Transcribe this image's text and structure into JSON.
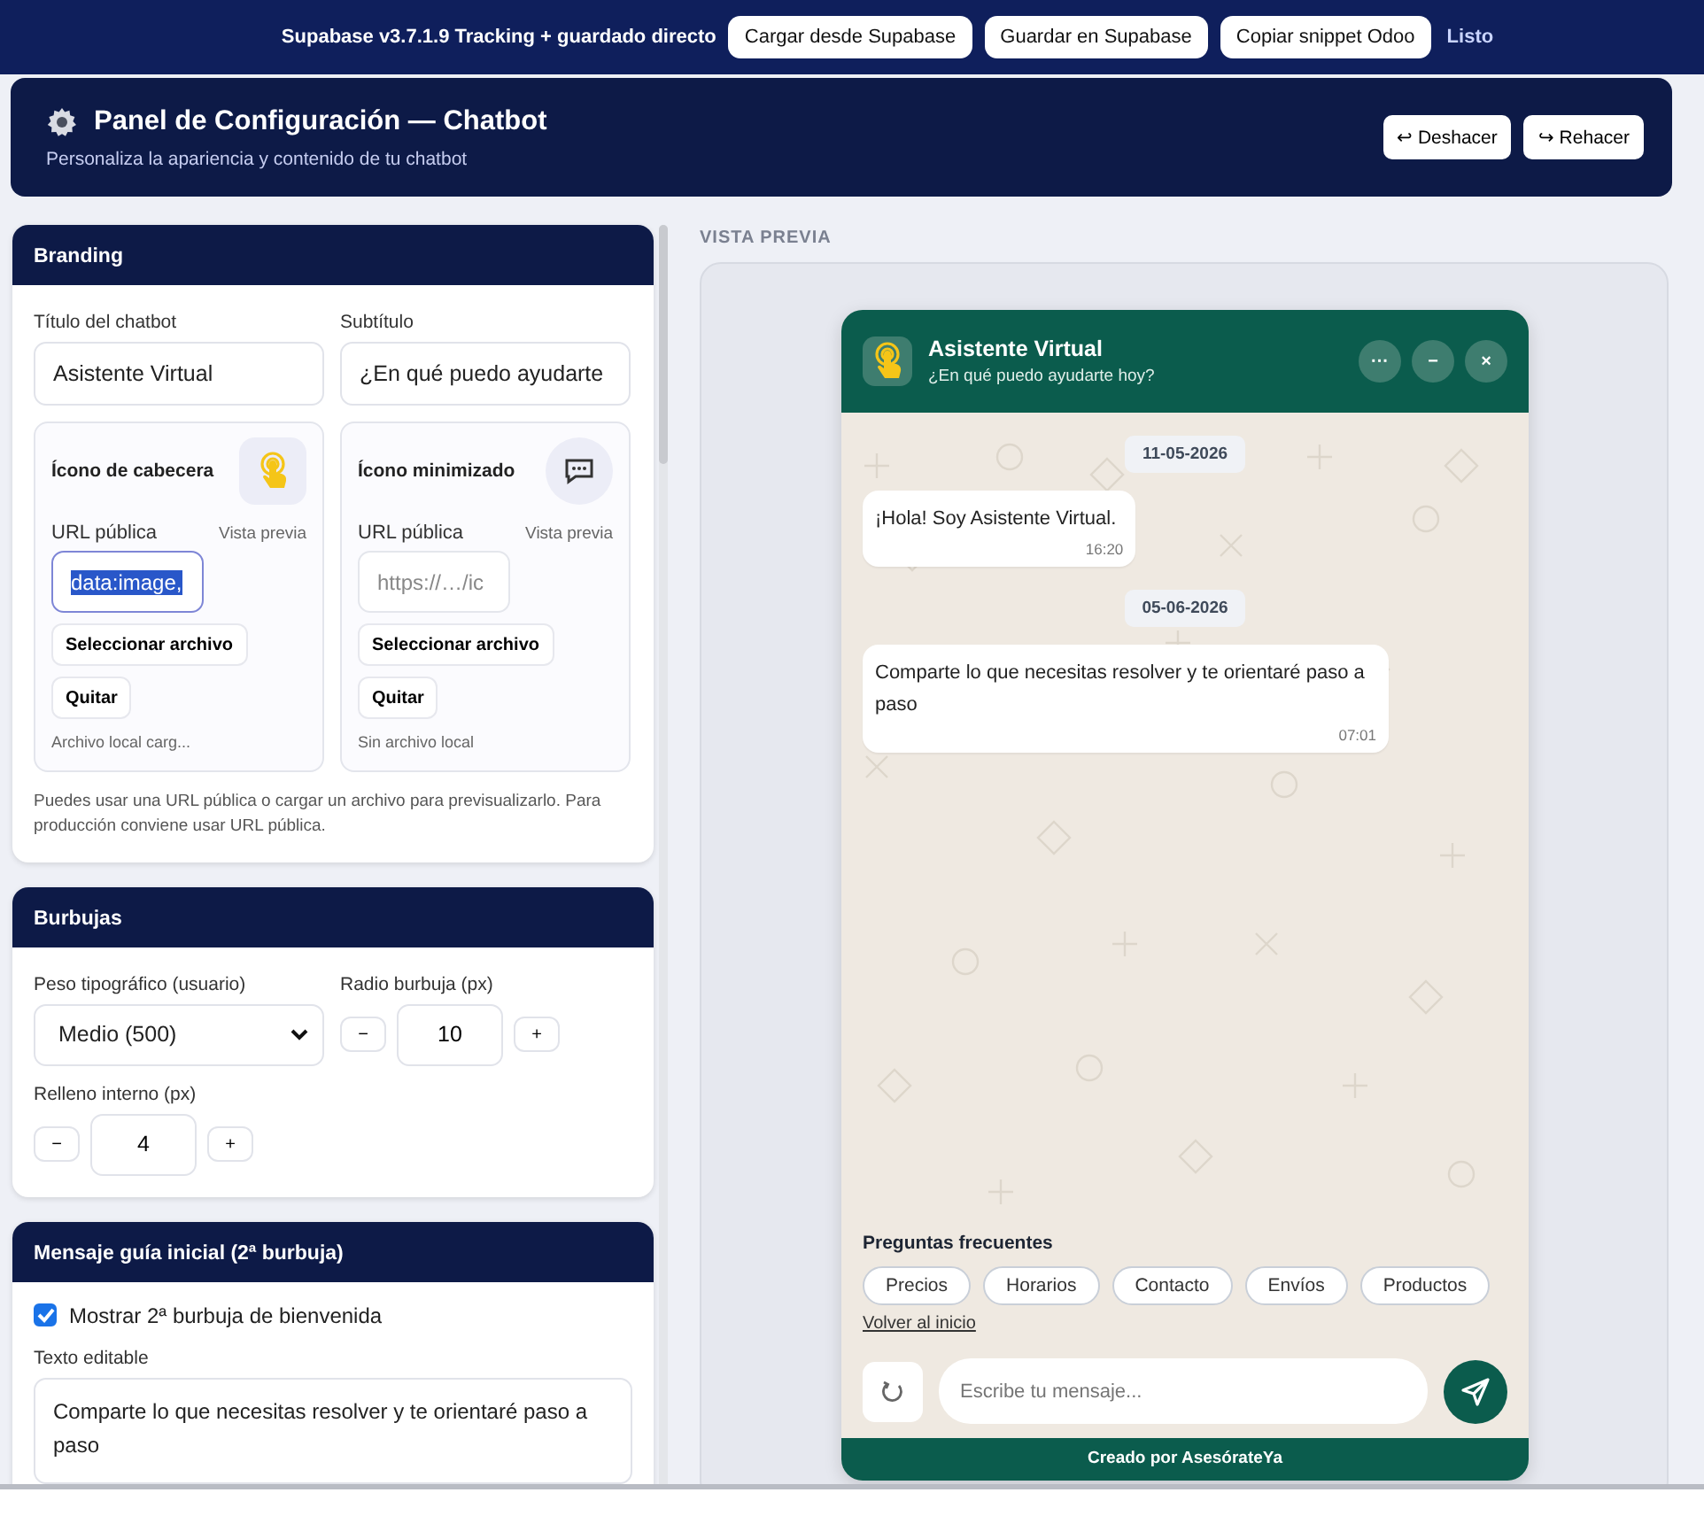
{
  "top_bar": {
    "title": "Supabase v3.7.1.9 Tracking + guardado directo",
    "buttons": [
      "Cargar desde Supabase",
      "Guardar en Supabase",
      "Copiar snippet Odoo"
    ],
    "link": "Listo"
  },
  "header": {
    "title": "Panel de Configuración — Chatbot",
    "subtitle": "Personaliza la apariencia y contenido de tu chatbot",
    "buttons": [
      "↩ Deshacer",
      "↪ Rehacer"
    ]
  },
  "branding": {
    "title": "Branding",
    "fields": [
      {
        "label": "Título del chatbot",
        "value": "Asistente Virtual"
      },
      {
        "label": "Subtítulo",
        "value": "¿En qué puedo ayudarte"
      }
    ],
    "icon_cards": [
      {
        "kind": "hand",
        "title": "Ícono de cabecera",
        "url_label": "URL pública",
        "preview_label": "Vista previa",
        "value": "data:image,",
        "selected": true,
        "select_button": "Seleccionar archivo",
        "remove_button": "Quitar",
        "status": "Archivo local carg..."
      },
      {
        "kind": "chat",
        "title": "Ícono minimizado",
        "url_label": "URL pública",
        "preview_label": "Vista previa",
        "placeholder": "https://…/ic",
        "selected": false,
        "select_button": "Seleccionar archivo",
        "remove_button": "Quitar",
        "status": "Sin archivo local"
      }
    ],
    "note": "Puedes usar una URL pública o cargar un archivo para previsualizarlo. Para producción conviene usar URL pública."
  },
  "bubbles": {
    "title": "Burbujas",
    "weight": {
      "label": "Peso tipográfico (usuario)",
      "value": "Medio (500)"
    },
    "steppers": [
      {
        "label": "Radio burbuja (px)",
        "value": "10",
        "minus": "−",
        "plus": "+"
      },
      {
        "label": "Relleno interno (px)",
        "value": "4",
        "minus": "−",
        "plus": "+"
      }
    ]
  },
  "guide": {
    "title": "Mensaje guía inicial (2ª burbuja)",
    "checkbox": {
      "label": "Mostrar 2ª burbuja de bienvenida",
      "checked": true
    },
    "text_label": "Texto editable",
    "text": "Comparte lo que necesitas resolver y te orientaré paso a paso"
  },
  "preview": {
    "label": "VISTA PREVIA",
    "chat": {
      "title": "Asistente Virtual",
      "subtitle": "¿En qué puedo ayudarte hoy?",
      "header_buttons": [
        "···",
        "−",
        "×"
      ],
      "messages": [
        {
          "kind": "date",
          "text": "11-05-2026"
        },
        {
          "kind": "bot",
          "text": "¡Hola! Soy Asistente Virtual.",
          "time": "16:20"
        },
        {
          "kind": "date",
          "text": "05-06-2026"
        },
        {
          "kind": "bot",
          "text": "Comparte lo que necesitas resolver y te orientaré paso a paso",
          "time": "07:01"
        }
      ],
      "faq_title": "Preguntas frecuentes",
      "faq": [
        "Precios",
        "Horarios",
        "Contacto",
        "Envíos",
        "Productos"
      ],
      "back_link": "Volver al inicio",
      "input_placeholder": "Escribe tu mensaje...",
      "footer": "Creado por AsesórateYa"
    }
  }
}
